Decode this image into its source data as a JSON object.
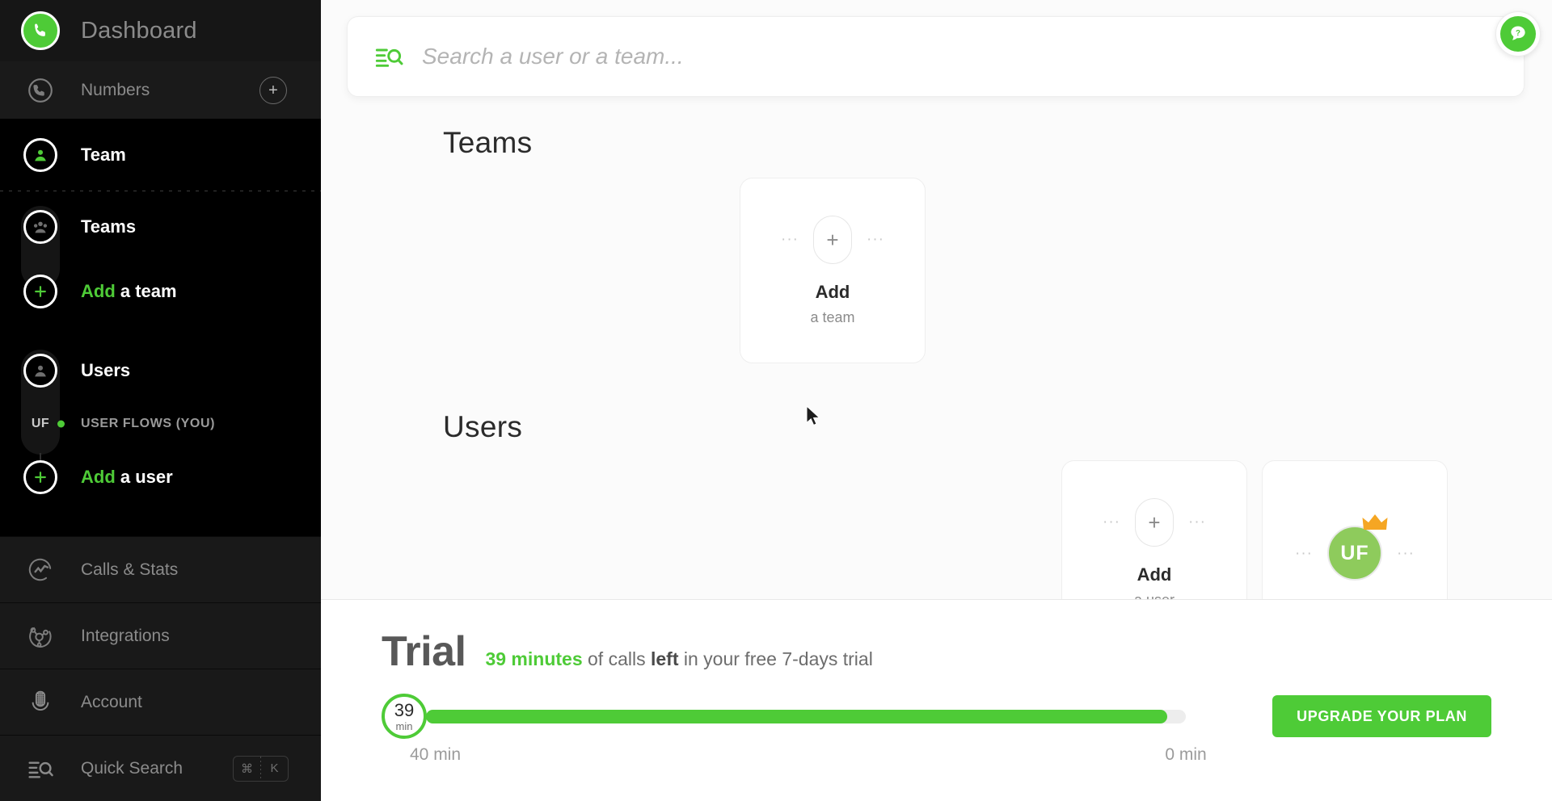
{
  "brand": {
    "title": "Dashboard",
    "logo_icon": "phone-circle-icon",
    "accent_color": "#4ecb37"
  },
  "sidebar": {
    "numbers": {
      "label": "Numbers",
      "icon": "phone-outline-icon",
      "add_icon": "plus-icon"
    },
    "team_header": {
      "label": "Team",
      "icon": "person-circle-icon"
    },
    "teams": {
      "label": "Teams",
      "icon": "group-circle-icon"
    },
    "add_team": {
      "label_accent": "Add",
      "label_rest": " a team",
      "icon": "plus-circle-icon"
    },
    "users": {
      "label": "Users",
      "icon": "user-circle-icon"
    },
    "user_flow": {
      "badge": "UF",
      "label": "USER FLOWS (YOU)",
      "status_dot_color": "#4ecb37"
    },
    "add_user": {
      "label_accent": "Add",
      "label_rest": " a user",
      "icon": "plus-circle-icon"
    },
    "bottom": [
      {
        "label": "Calls & Stats",
        "icon": "analytics-icon"
      },
      {
        "label": "Integrations",
        "icon": "integrations-icon"
      },
      {
        "label": "Account",
        "icon": "account-icon"
      }
    ],
    "quick_search": {
      "label": "Quick Search",
      "icon": "search-list-icon",
      "shortcut_mod": "⌘",
      "shortcut_key": "K"
    }
  },
  "search": {
    "placeholder": "Search a user or a team...",
    "value": "",
    "icon": "search-list-icon"
  },
  "help": {
    "icon": "help-bubble-icon",
    "glyph": "?"
  },
  "teams_section": {
    "title": "Teams",
    "cards": [
      {
        "type": "add",
        "name": "Add",
        "sub": "a team",
        "icon": "plus-icon",
        "dots": "···"
      }
    ]
  },
  "users_section": {
    "title": "Users",
    "cards": [
      {
        "type": "add",
        "name": "Add",
        "sub": "a user",
        "icon": "plus-icon",
        "dots": "···"
      },
      {
        "type": "user",
        "initials": "UF",
        "badge_icon": "crown-icon",
        "dots": "···"
      }
    ]
  },
  "trial": {
    "heading": "Trial",
    "msg_amount": "39 minutes",
    "msg_mid": " of calls ",
    "msg_bold": "left",
    "msg_tail": " in your free 7-days trial",
    "knob_value": "39",
    "knob_unit": "min",
    "left_label": "40 min",
    "right_label": "0 min",
    "progress_percent": 97.5,
    "upgrade_label": "UPGRADE YOUR PLAN",
    "bar_color": "#4ecb37"
  }
}
